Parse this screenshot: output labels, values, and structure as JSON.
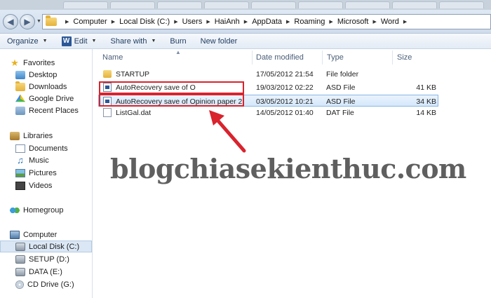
{
  "address": {
    "crumbs": [
      "Computer",
      "Local Disk (C:)",
      "Users",
      "HaiAnh",
      "AppData",
      "Roaming",
      "Microsoft",
      "Word"
    ]
  },
  "toolbar": {
    "organize": "Organize",
    "edit": "Edit",
    "share": "Share with",
    "burn": "Burn",
    "new_folder": "New folder"
  },
  "sidebar": {
    "favorites": "Favorites",
    "desktop": "Desktop",
    "downloads": "Downloads",
    "google_drive": "Google Drive",
    "recent_places": "Recent Places",
    "libraries": "Libraries",
    "documents": "Documents",
    "music": "Music",
    "pictures": "Pictures",
    "videos": "Videos",
    "homegroup": "Homegroup",
    "computer": "Computer",
    "local_disk": "Local Disk (C:)",
    "setup": "SETUP (D:)",
    "data": "DATA (E:)",
    "cd_drive": "CD Drive (G:)"
  },
  "columns": {
    "name": "Name",
    "date": "Date modified",
    "type": "Type",
    "size": "Size"
  },
  "files": [
    {
      "name": "STARTUP",
      "date": "17/05/2012 21:54",
      "type": "File folder",
      "size": ""
    },
    {
      "name": "AutoRecovery save of O",
      "date": "19/03/2012 02:22",
      "type": "ASD File",
      "size": "41 KB"
    },
    {
      "name": "AutoRecovery save of Opinion paper 2",
      "date": "03/05/2012 10:21",
      "type": "ASD File",
      "size": "34 KB"
    },
    {
      "name": "ListGal.dat",
      "date": "14/05/2012 01:40",
      "type": "DAT File",
      "size": "14 KB"
    }
  ],
  "watermark": "blogchiasekienthuc.com",
  "colors": {
    "highlight_box": "#d9232d",
    "selection": "#d6e8fb"
  }
}
